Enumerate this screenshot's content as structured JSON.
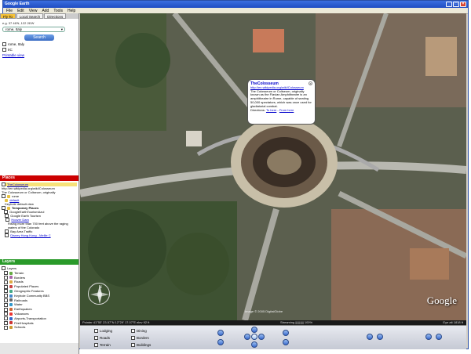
{
  "window": {
    "title": "Google Earth"
  },
  "menu": [
    "File",
    "Edit",
    "View",
    "Add",
    "Tools",
    "Help"
  ],
  "tabs": [
    "Fly To",
    "Local Search",
    "Directions"
  ],
  "search": {
    "coords": "e.g. 37 46'N, 122 26'W",
    "query": "rome, Italy",
    "button": "Search",
    "results": [
      "rome, Italy",
      "IIC"
    ],
    "printable": "Printable view"
  },
  "places": {
    "header": "Places",
    "items": [
      {
        "label": "TheColosseum",
        "note": "http://en.wikipedia.org/wiki/Colosseum"
      },
      {
        "label": "The Colosseum or Coliseum, originally",
        "note": ""
      },
      {
        "label": "rome",
        "note": ""
      },
      {
        "label": "default",
        "note": ""
      },
      {
        "label": "Keyhole default view",
        "note": ""
      },
      {
        "label": "Temporary Places",
        "note": ""
      },
      {
        "label": "GoogleEarthTourismAzul",
        "note": ""
      },
      {
        "label": "Google Earth Tourism",
        "note": ""
      },
      {
        "label": "Hoover Dam",
        "note": ""
      },
      {
        "label": "Rising more than 700 feet above the raging waters of the Colorado",
        "note": ""
      },
      {
        "label": "Bay Area Traffic",
        "note": ""
      },
      {
        "label": "Disney Hong Kong - Mellie C",
        "note": ""
      }
    ]
  },
  "layers": {
    "header": "Layers",
    "items": [
      "Layers",
      "Terrain",
      "Borders",
      "Roads",
      "Populated Places",
      "Geographic Features",
      "Keyhole Community BBS",
      "Railroads",
      "Water",
      "Earthquakes",
      "Volcanoes",
      "Airports-Transportation",
      "Fire/Hospitals",
      "Schools"
    ]
  },
  "balloon": {
    "title": "TheColosseum",
    "link": "http://en.wikipedia.org/wiki/Colosseum",
    "body": "The Colosseum or Coliseum, originally known as the Flavian Amphitheatre is an amphitheatre in Rome, capable of seating 50,000 spectators, which was once used for gladiatorial combat.",
    "directions_label": "Directions:",
    "to_here": "To here",
    "from_here": "From here"
  },
  "map": {
    "attribution": "Image © 2005 DigitalGlobe",
    "logo": "Google"
  },
  "status": {
    "pointer": "Pointer 41°53' 23.57\"N 12°29' 17.07\"E elev 92 ft",
    "streaming": "Streaming |||||||||| 100%",
    "eye_alt": "Eye alt 1818 ft"
  },
  "toolbar": {
    "checks": [
      "Lodging",
      "Dining",
      "Roads",
      "Borders",
      "Terrain",
      "Buildings"
    ]
  }
}
